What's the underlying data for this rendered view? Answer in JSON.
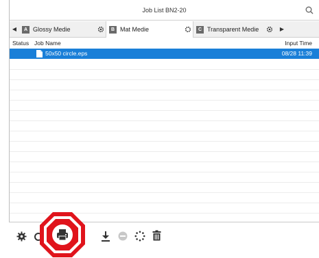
{
  "window": {
    "title": "Job List BN2-20"
  },
  "tabs": [
    {
      "letter": "A",
      "label": "Glossy Medie"
    },
    {
      "letter": "B",
      "label": "Mat Medie"
    },
    {
      "letter": "C",
      "label": "Transparent Medie"
    }
  ],
  "columns": {
    "status": "Status",
    "job_name": "Job Name",
    "input_time": "Input Time"
  },
  "jobs": [
    {
      "name": "50x50 circle.eps",
      "input_time": "08/28 11:39",
      "selected": true
    }
  ],
  "toolbar": {
    "icons": [
      "gear-icon",
      "print-icon",
      "download-icon",
      "cancel-icon",
      "loading-icon",
      "trash-icon"
    ],
    "highlight_color": "#e0141c"
  },
  "colors": {
    "selection": "#1a7fd8"
  }
}
